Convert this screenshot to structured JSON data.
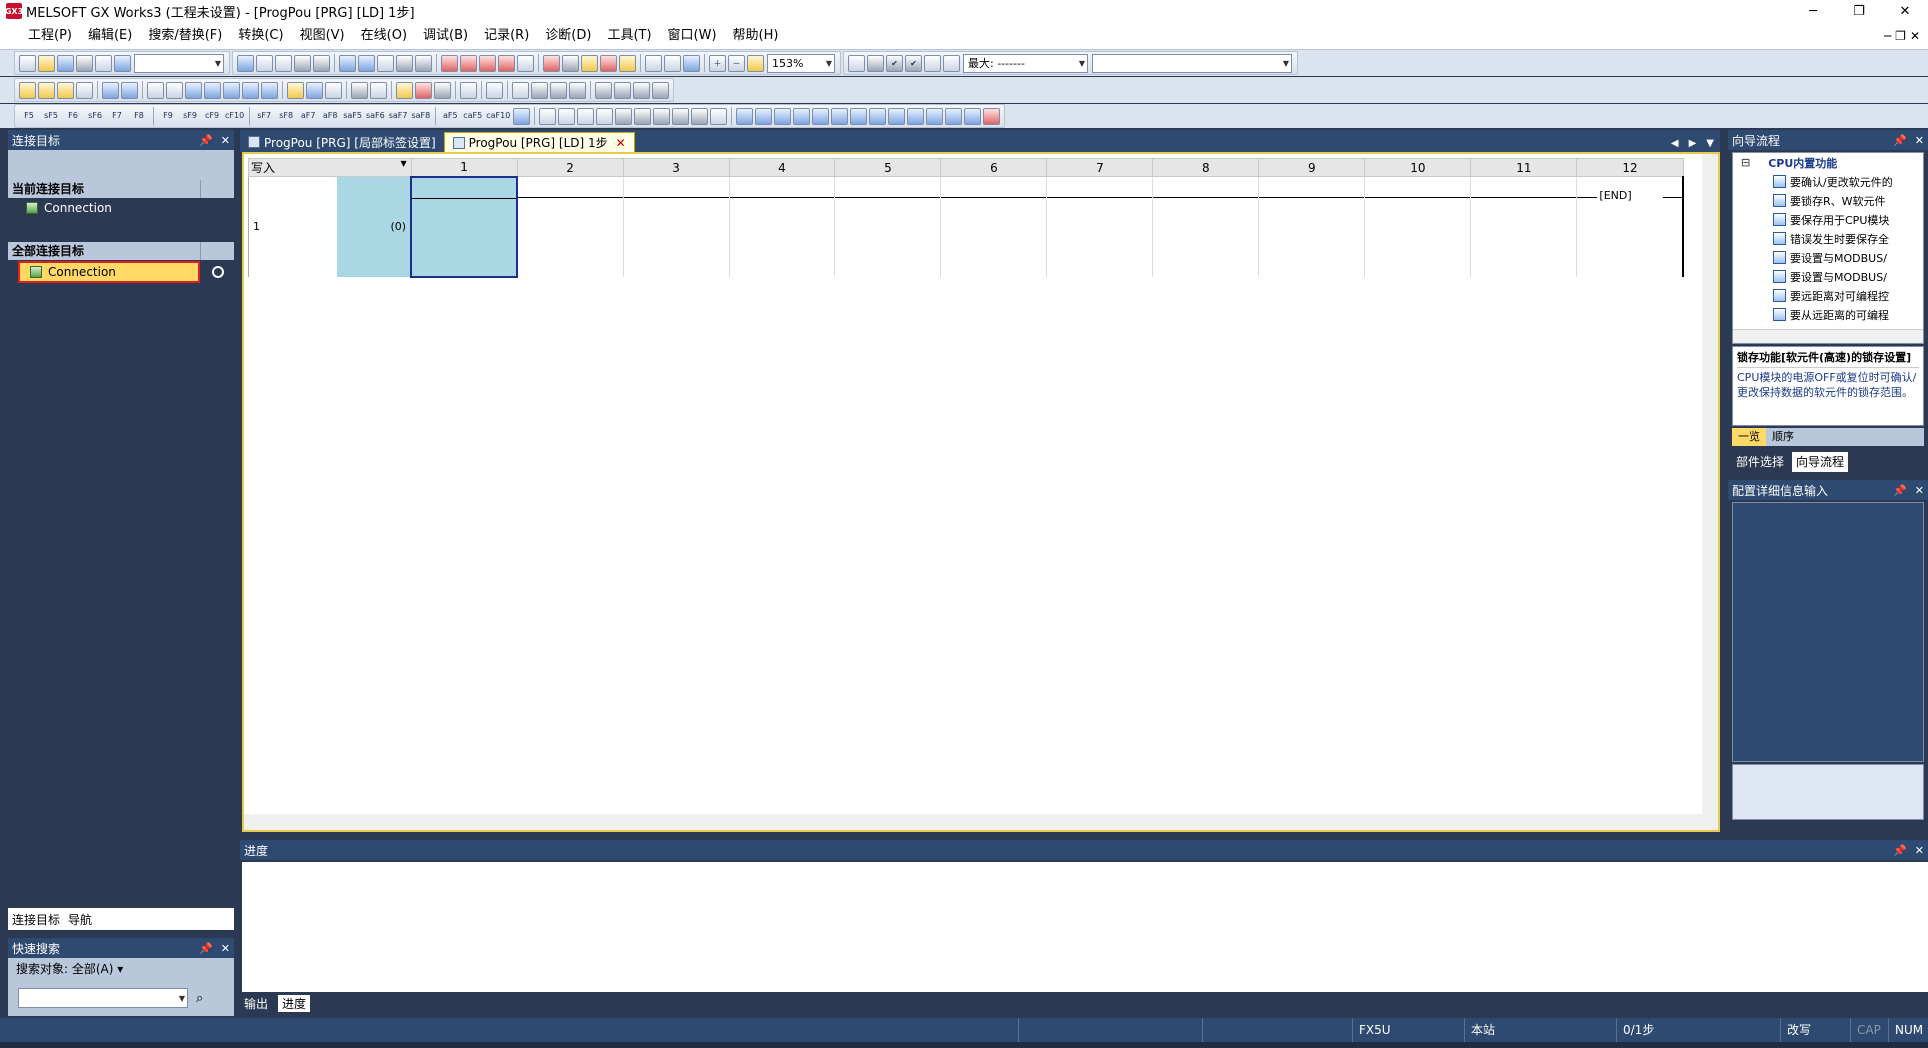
{
  "window": {
    "title": "MELSOFT GX Works3 (工程未设置) - [ProgPou [PRG] [LD] 1步]",
    "app_icon": "GX3",
    "minimize": "─",
    "maximize": "❐",
    "close": "✕"
  },
  "menu": {
    "items": [
      "工程(P)",
      "编辑(E)",
      "搜索/替换(F)",
      "转换(C)",
      "视图(V)",
      "在线(O)",
      "调试(B)",
      "记录(R)",
      "诊断(D)",
      "工具(T)",
      "窗口(W)",
      "帮助(H)"
    ],
    "mdi_minimize": "─",
    "mdi_restore": "❐",
    "mdi_close": "✕"
  },
  "toolbar": {
    "zoom": "153%",
    "max_label": "最大: -------",
    "fkeys": [
      "F5",
      "sF5",
      "F6",
      "sF6",
      "F7",
      "F8",
      "F9",
      "sF9",
      "cF9",
      "cF10",
      "sF7",
      "sF8",
      "aF7",
      "aF8",
      "saF5",
      "saF6",
      "saF7",
      "saF8",
      "aF5",
      "caF5",
      "caF10"
    ]
  },
  "left_panel": {
    "title": "连接目标",
    "current_section": "当前连接目标",
    "current_item": "Connection",
    "all_section": "全部连接目标",
    "all_item": "Connection",
    "tabs": [
      "连接目标",
      "导航"
    ]
  },
  "quick_search": {
    "title": "快速搜索",
    "scope": "搜索对象: 全部(A) ▾"
  },
  "editor": {
    "tabs": [
      "ProgPou [PRG] [局部标签设置]",
      "ProgPou [PRG] [LD] 1步"
    ],
    "mode_label": "写入",
    "columns": [
      "1",
      "2",
      "3",
      "4",
      "5",
      "6",
      "7",
      "8",
      "9",
      "10",
      "11",
      "12"
    ],
    "row_number": "1",
    "step_label": "(0)",
    "end_label": "END"
  },
  "wizard": {
    "title": "向导流程",
    "root": "CPU内置功能",
    "items": [
      "要确认/更改软元件的",
      "要锁存R、W软元件",
      "要保存用于CPU模块",
      "错误发生时要保存全",
      "要设置与MODBUS/",
      "要设置与MODBUS/",
      "要远距离对可编程控",
      "要从远距离的可编程"
    ],
    "desc_title": "锁存功能[软元件(高速)的锁存设置]",
    "desc_text": "CPU模块的电源OFF或复位时可确认/更改保持数据的软元件的锁存范围。",
    "subtabs": [
      "一览",
      "顺序"
    ],
    "bottom_tabs": [
      "部件选择",
      "向导流程"
    ]
  },
  "config_panel": {
    "title": "配置详细信息输入"
  },
  "output_panel": {
    "title": "进度",
    "tabs": [
      "输出",
      "进度"
    ]
  },
  "statusbar": {
    "cpu": "FX5U",
    "station": "本站",
    "steps": "0/1步",
    "mode": "改写",
    "cap": "CAP",
    "num": "NUM"
  }
}
